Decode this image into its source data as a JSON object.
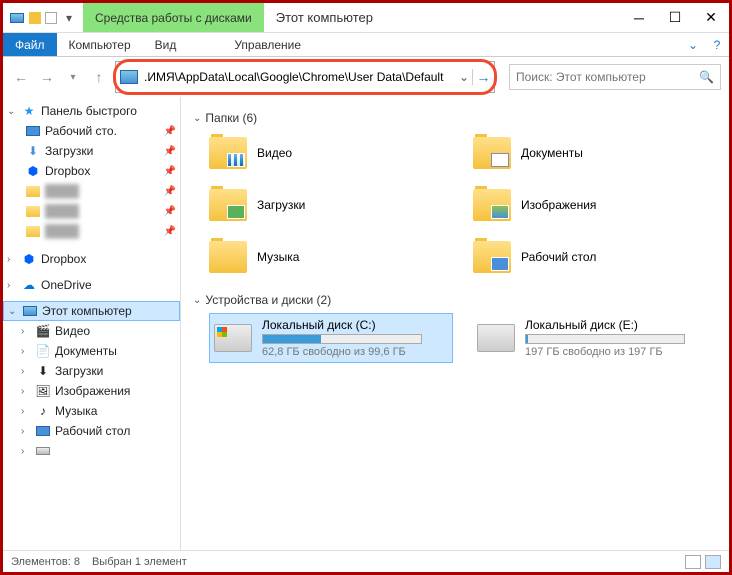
{
  "titlebar": {
    "context_tab": "Средства работы с дисками",
    "title": "Этот компьютер"
  },
  "ribbon": {
    "file": "Файл",
    "computer": "Компьютер",
    "view": "Вид",
    "manage": "Управление"
  },
  "address": {
    "path": ".ИМЯ\\AppData\\Local\\Google\\Chrome\\User Data\\Default"
  },
  "search": {
    "placeholder": "Поиск: Этот компьютер"
  },
  "sidebar": {
    "quick_access": "Панель быстрого",
    "items_pinned": [
      {
        "label": "Рабочий сто.",
        "icon": "desktop"
      },
      {
        "label": "Загрузки",
        "icon": "down"
      },
      {
        "label": "Dropbox",
        "icon": "dropbox"
      },
      {
        "label": "",
        "icon": "folder",
        "blur": true
      },
      {
        "label": "",
        "icon": "folder",
        "blur": true
      },
      {
        "label": "",
        "icon": "folder",
        "blur": true
      }
    ],
    "dropbox": "Dropbox",
    "onedrive": "OneDrive",
    "this_pc": "Этот компьютер",
    "this_pc_items": [
      {
        "label": "Видео"
      },
      {
        "label": "Документы"
      },
      {
        "label": "Загрузки"
      },
      {
        "label": "Изображения"
      },
      {
        "label": "Музыка"
      },
      {
        "label": "Рабочий стол"
      },
      {
        "label": ""
      }
    ]
  },
  "main": {
    "folders_header": "Папки (6)",
    "folders": [
      {
        "label": "Видео",
        "ov": "video"
      },
      {
        "label": "Документы",
        "ov": "doc"
      },
      {
        "label": "Загрузки",
        "ov": "down"
      },
      {
        "label": "Изображения",
        "ov": "img"
      },
      {
        "label": "Музыка",
        "ov": "music"
      },
      {
        "label": "Рабочий стол",
        "ov": "desk"
      }
    ],
    "drives_header": "Устройства и диски (2)",
    "drives": [
      {
        "label": "Локальный диск (C:)",
        "sub": "62,8 ГБ свободно из 99,6 ГБ",
        "fill": 37,
        "win": true,
        "selected": true
      },
      {
        "label": "Локальный диск (E:)",
        "sub": "197 ГБ свободно из 197 ГБ",
        "fill": 1,
        "win": false,
        "selected": false
      }
    ]
  },
  "status": {
    "count": "Элементов: 8",
    "selection": "Выбран 1 элемент"
  }
}
